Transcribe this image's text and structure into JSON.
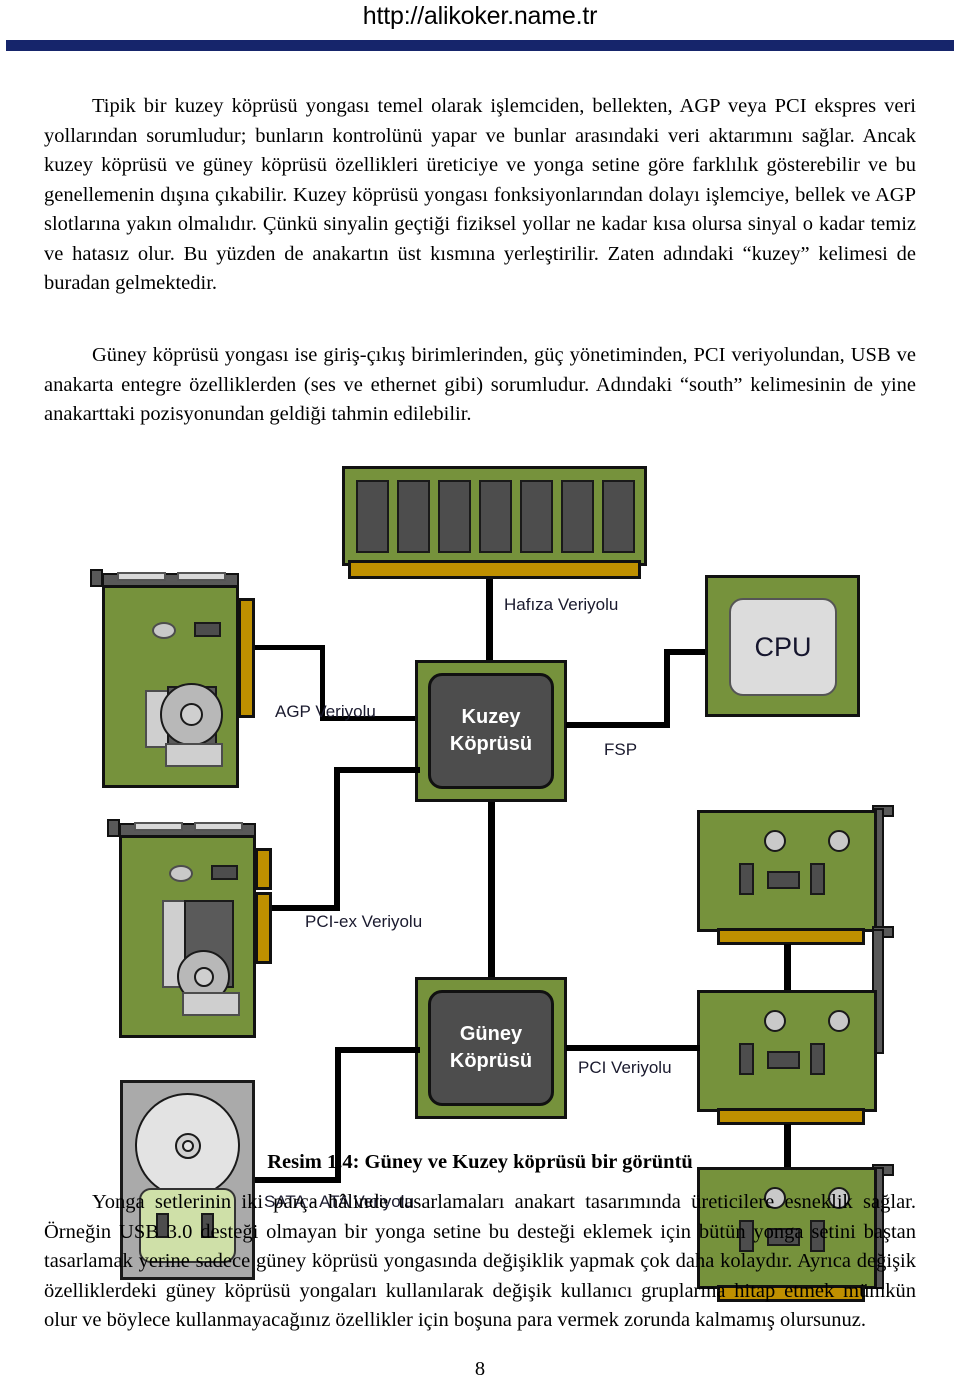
{
  "header": {
    "site_url": "http://alikoker.name.tr"
  },
  "paragraphs": {
    "p1": "Tipik bir kuzey köprüsü yongası temel olarak işlemciden, bellekten, AGP veya PCI ekspres veri yollarından sorumludur; bunların kontrolünü yapar ve bunlar arasındaki veri aktarımını sağlar. Ancak kuzey köprüsü ve güney köprüsü özellikleri üreticiye ve yonga setine göre farklılık gösterebilir ve bu genellemenin dışına çıkabilir. Kuzey köprüsü yongası fonksiyonlarından dolayı işlemciye, bellek ve AGP slotlarına yakın olmalıdır. Çünkü sinyalin geçtiği fiziksel yollar ne kadar kısa olursa sinyal o kadar temiz ve hatasız olur. Bu yüzden de anakartın üst kısmına yerleştirilir. Zaten adındaki “kuzey” kelimesi de buradan gelmektedir.",
    "p2": "Güney köprüsü yongası ise giriş-çıkış birimlerinden, güç yönetiminden, PCI veriyolundan, USB ve anakarta entegre özelliklerden (ses ve ethernet gibi) sorumludur. Adındaki “south” kelimesinin de yine anakarttaki pozisyonundan geldiği tahmin edilebilir.",
    "p3": "Yonga setlerinin iki parça hâlinde tasarlamaları anakart tasarımında üreticilere esneklik sağlar. Örneğin USB 3.0 desteği olmayan bir yonga setine bu desteği eklemek için bütün yonga setini baştan tasarlamak yerine sadece güney köprüsü yongasında değişiklik yapmak çok daha kolaydır. Ayrıca değişik özelliklerdeki güney köprüsü yongaları kullanılarak değişik kullanıcı gruplarına hitap etmek mümkün olur ve böylece kullanmayacağınız özellikler için boşuna para vermek zorunda kalmamış olursunuz."
  },
  "figure": {
    "caption": "Resim 1.4: Güney ve Kuzey köprüsü bir görüntü",
    "nodes": {
      "memory": "",
      "northbridge_line1": "Kuzey",
      "northbridge_line2": "Köprüsü",
      "southbridge_line1": "Güney",
      "southbridge_line2": "Köprüsü",
      "cpu": "CPU"
    },
    "bus_labels": {
      "memory_bus": "Hafıza Veriyolu",
      "agp_bus": "AGP Veriyolu",
      "fsp_bus": "FSP",
      "pcie_bus": "PCI-ex Veriyolu",
      "pci_bus": "PCI Veriyolu",
      "sata_bus": "SATA - ATA Veriyolu"
    },
    "colors": {
      "pcb_green": "#76923c",
      "chip_dark": "#4d4d4d",
      "gold_connector": "#bf9000",
      "grey_device": "#aaaaaa",
      "pale_green": "#cfe0a8",
      "cpu_core": "#dcdcdc",
      "header_rule": "#16256b"
    },
    "memory_chip_count": 7
  },
  "page_number": "8"
}
